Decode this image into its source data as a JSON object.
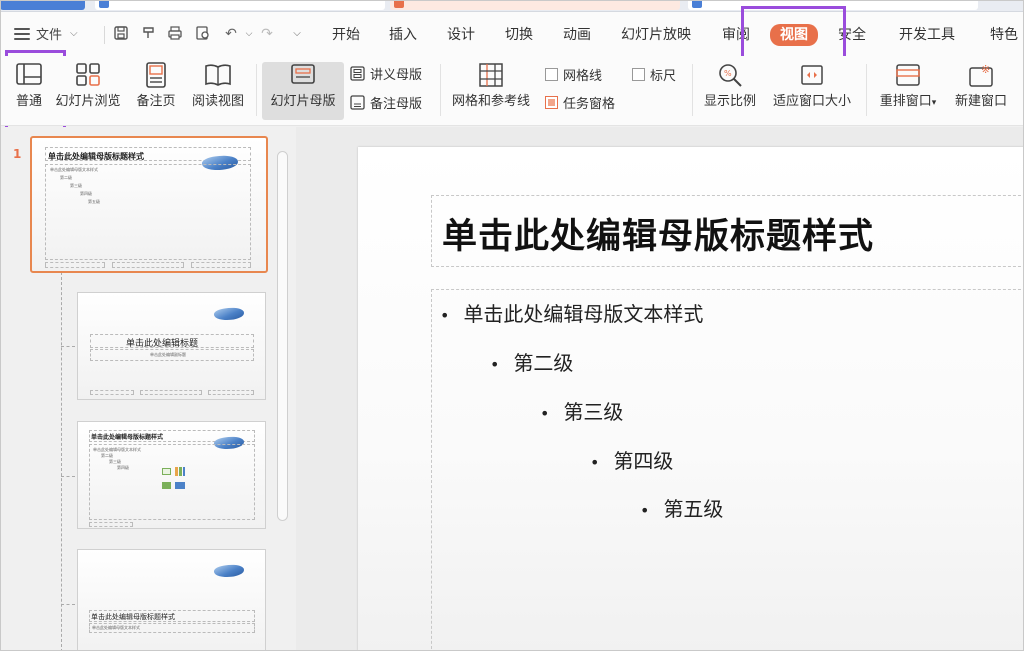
{
  "menu": {
    "file_label": "文件",
    "tabs": [
      "开始",
      "插入",
      "设计",
      "切换",
      "动画",
      "幻灯片放映",
      "审阅",
      "视图",
      "安全",
      "开发工具",
      "特色"
    ],
    "active_tab": "视图"
  },
  "ribbon": {
    "normal": "普通",
    "slide_sorter": "幻灯片浏览",
    "notes_page": "备注页",
    "reading_view": "阅读视图",
    "slide_master": "幻灯片母版",
    "handout_master": "讲义母版",
    "notes_master": "备注母版",
    "grid_guides": "网格和参考线",
    "gridlines": "网格线",
    "ruler": "标尺",
    "task_pane": "任务窗格",
    "zoom": "显示比例",
    "fit_window": "适应窗口大小",
    "arrange": "重排窗口",
    "new_window": "新建窗口"
  },
  "thumbnails": {
    "number": "1",
    "t1_title": "单击此处编辑母版标题样式",
    "t1_lines": [
      "单击此处编辑母版文本样式",
      "第二级",
      "第三级",
      "第四级",
      "第五级"
    ],
    "t2_title": "单击此处编辑标题",
    "t2_sub": "单击此处编辑副标题",
    "t3_title": "单击此处编辑母版标题样式",
    "t3_lines": [
      "单击此处编辑母版文本样式",
      "第二级",
      "第三级",
      "第四级"
    ],
    "t4_title": "单击此处编辑母版标题样式",
    "t4_sub": "单击此处编辑母版文本样式"
  },
  "slide": {
    "title": "单击此处编辑母版标题样式",
    "levels": [
      "单击此处编辑母版文本样式",
      "第二级",
      "第三级",
      "第四级",
      "第五级"
    ]
  },
  "colors": {
    "accent": "#e8704a",
    "highlight_box": "#9a4cdc"
  }
}
